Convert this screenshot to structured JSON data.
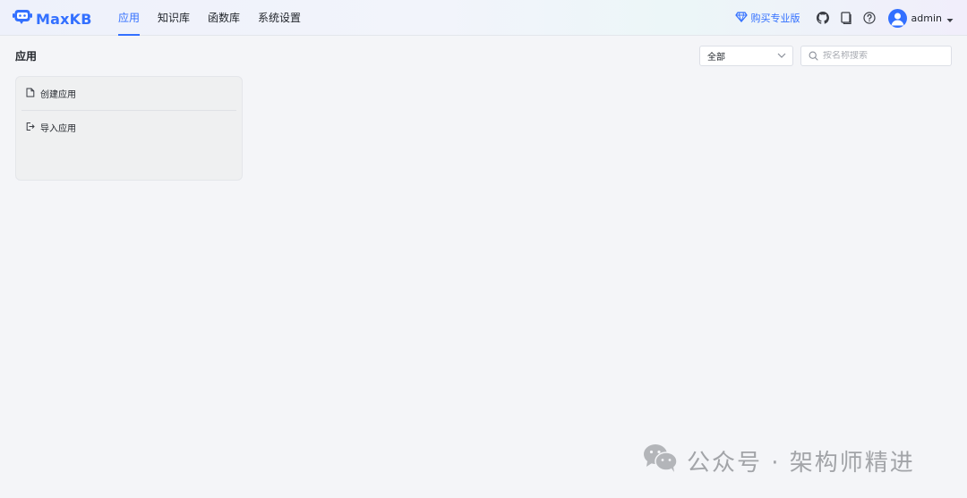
{
  "header": {
    "logo_text": "MaxKB",
    "nav": [
      {
        "label": "应用",
        "active": true
      },
      {
        "label": "知识库",
        "active": false
      },
      {
        "label": "函数库",
        "active": false
      },
      {
        "label": "系统设置",
        "active": false
      }
    ],
    "upgrade_label": "购买专业版",
    "user": {
      "name": "admin"
    }
  },
  "page": {
    "title": "应用",
    "filter": {
      "selected": "全部"
    },
    "search": {
      "placeholder": "按名称搜索",
      "value": ""
    }
  },
  "create_card": {
    "create_label": "创建应用",
    "import_label": "导入应用"
  },
  "watermark": {
    "text": "公众号 · 架构师精进"
  },
  "colors": {
    "accent": "#3370ff",
    "background": "#f4f5f8",
    "text": "#1f2329",
    "muted": "#a8abb2"
  }
}
